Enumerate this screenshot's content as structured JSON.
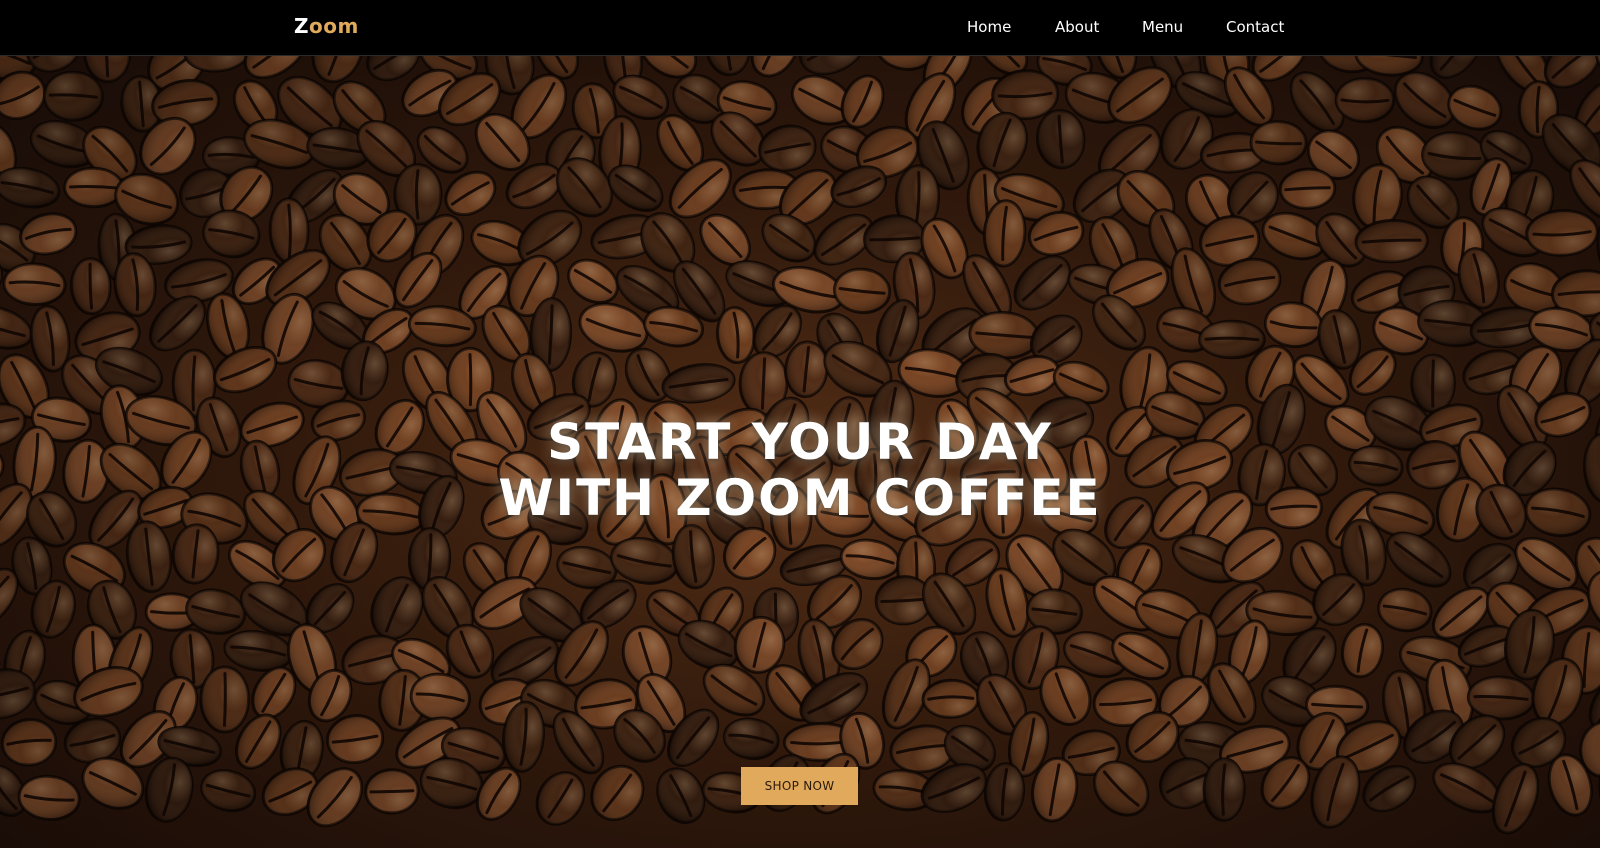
{
  "brand": {
    "name_first_letter": "Z",
    "name_rest": "oom",
    "accent_color": "#e0a95b"
  },
  "nav": {
    "items": [
      {
        "label": "Home"
      },
      {
        "label": "About"
      },
      {
        "label": "Menu"
      },
      {
        "label": "Contact"
      }
    ]
  },
  "hero": {
    "headline_line1": "START YOUR DAY",
    "headline_line2": "WITH ZOOM COFFEE",
    "cta_label": "SHOP NOW",
    "background_image": "coffee-beans"
  }
}
